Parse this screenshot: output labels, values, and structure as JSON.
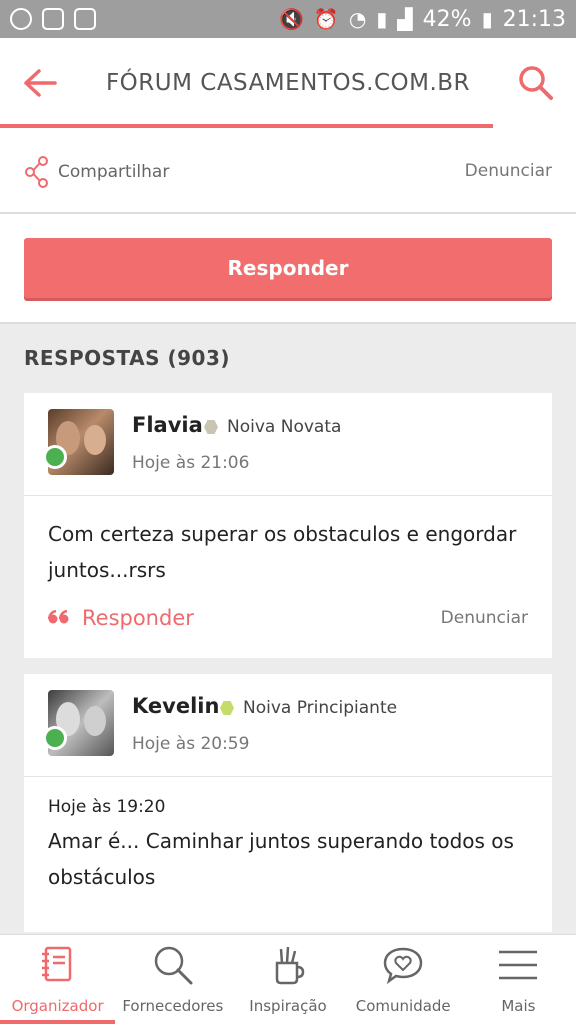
{
  "status_bar": {
    "battery_percent": "42%",
    "time": "21:13"
  },
  "header": {
    "title": "FÓRUM CASAMENTOS.COM.BR"
  },
  "share": {
    "label": "Compartilhar",
    "report_label": "Denunciar"
  },
  "reply_button": {
    "label": "Responder"
  },
  "answers": {
    "heading": "RESPOSTAS (903)",
    "items": [
      {
        "user": "Flavia",
        "badge": "Noiva Novata",
        "time": "Hoje às 21:06",
        "message": "Com certeza superar os obstaculos e engordar juntos...rsrs",
        "reply_label": "Responder",
        "report_label": "Denunciar"
      },
      {
        "user": "Kevelin",
        "badge": "Noiva Principiante",
        "time": "Hoje às 20:59",
        "quote_time": "Hoje às 19:20",
        "message": "Amar é... Caminhar juntos superando todos os obstáculos"
      }
    ]
  },
  "bottom_nav": {
    "items": [
      {
        "label": "Organizador",
        "icon": "notebook-icon",
        "active": true
      },
      {
        "label": "Fornecedores",
        "icon": "search-icon"
      },
      {
        "label": "Inspiração",
        "icon": "pencil-cup-icon"
      },
      {
        "label": "Comunidade",
        "icon": "chat-heart-icon"
      },
      {
        "label": "Mais",
        "icon": "menu-icon"
      }
    ]
  },
  "colors": {
    "accent": "#ef6a6c",
    "button": "#f26d6d",
    "online": "#4caf50"
  }
}
